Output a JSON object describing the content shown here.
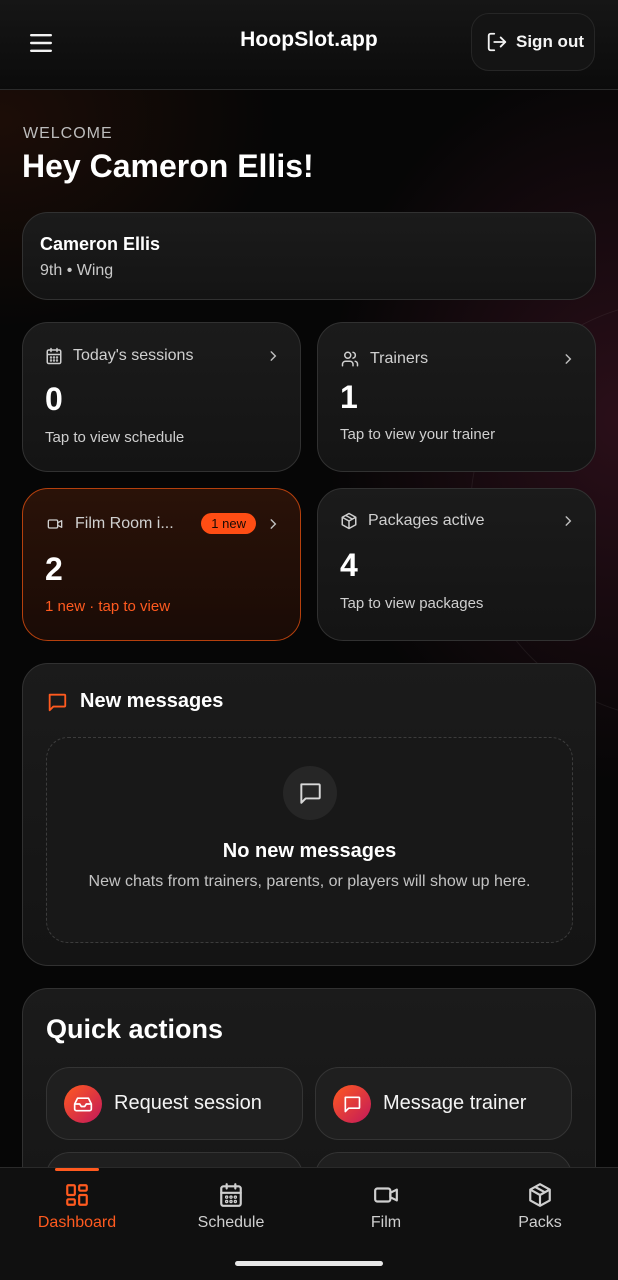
{
  "header": {
    "app_title": "HoopSlot.app",
    "signout_label": "Sign out",
    "menu_icon": "hamburger-menu-icon",
    "signout_icon": "logout-icon"
  },
  "welcome": {
    "label": "WELCOME",
    "title": "Hey Cameron Ellis!"
  },
  "profile": {
    "name": "Cameron Ellis",
    "subtitle": "9th • Wing"
  },
  "stats": [
    {
      "icon": "calendar-icon",
      "label": "Today's sessions",
      "value": "0",
      "subtitle": "Tap to view schedule"
    },
    {
      "icon": "users-icon",
      "label": "Trainers",
      "value": "1",
      "subtitle": "Tap to view your trainer"
    },
    {
      "icon": "video-icon",
      "label": "Film Room i...",
      "badge": "1 new",
      "value": "2",
      "subtitle": "1 new · tap to view"
    },
    {
      "icon": "package-icon",
      "label": "Packages active",
      "value": "4",
      "subtitle": "Tap to view packages"
    }
  ],
  "messages": {
    "title": "New messages",
    "empty_title": "No new messages",
    "empty_subtitle": "New chats from trainers, parents, or players will show up here."
  },
  "quick_actions": {
    "title": "Quick actions",
    "items": [
      {
        "label": "Request session",
        "icon": "inbox-icon"
      },
      {
        "label": "Message trainer",
        "icon": "chat-icon"
      }
    ]
  },
  "bottom_nav": {
    "items": [
      {
        "label": "Dashboard",
        "icon": "dashboard-icon",
        "active": true
      },
      {
        "label": "Schedule",
        "icon": "calendar-icon"
      },
      {
        "label": "Film",
        "icon": "video-icon"
      },
      {
        "label": "Packs",
        "icon": "package-icon"
      }
    ]
  },
  "colors": {
    "accent": "#ff5a1f",
    "background": "#060606",
    "card": "#1b1b1b"
  }
}
